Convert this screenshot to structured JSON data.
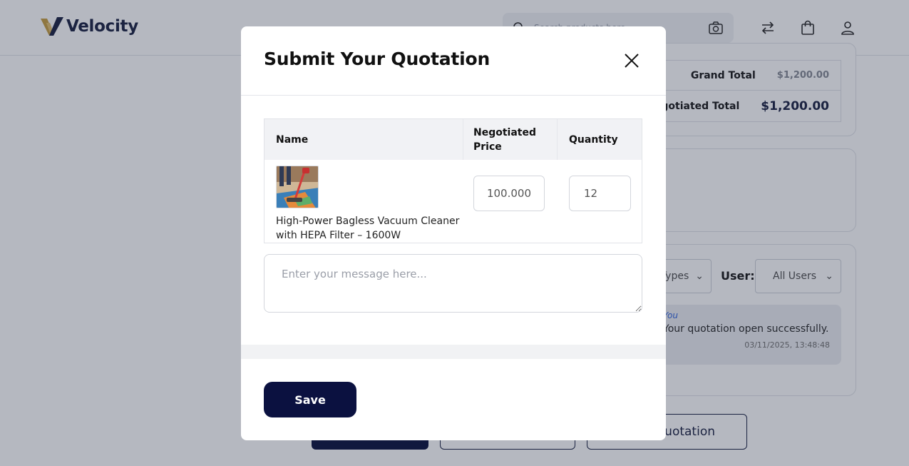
{
  "app": {
    "brand_name": "Velocity",
    "brand_colors": {
      "navy": "#232a4a",
      "gold": "#c9a24a"
    }
  },
  "header": {
    "search_placeholder": "Search products here",
    "icons": [
      "search-icon",
      "camera-icon",
      "compare-icon",
      "cart-icon",
      "user-icon"
    ]
  },
  "background": {
    "totals": {
      "grand_total_label": "Grand Total",
      "grand_total_value": "$1,200.00",
      "negotiated_total_label": "Negotiated Total",
      "negotiated_total_value": "$1,200.00"
    },
    "filters": {
      "type_select_value": "All Types",
      "user_label": "User:",
      "user_select_value": "All Users"
    },
    "message": {
      "author": "You",
      "text": "Your quotation open successfully.",
      "timestamp": "03/11/2025, 13:48:48"
    },
    "actions": {
      "open_quotation_label": "Open Quotation"
    }
  },
  "modal": {
    "title": "Submit Your Quotation",
    "table": {
      "headers": {
        "name": "Name",
        "price": "Negotiated Price",
        "quantity": "Quantity"
      },
      "rows": [
        {
          "name": "High-Power Bagless Vacuum Cleaner with HEPA Filter – 1600W",
          "price": "100.000",
          "quantity": "12"
        }
      ]
    },
    "message_placeholder": "Enter your message here...",
    "save_label": "Save",
    "primary_color": "#0b1140"
  }
}
